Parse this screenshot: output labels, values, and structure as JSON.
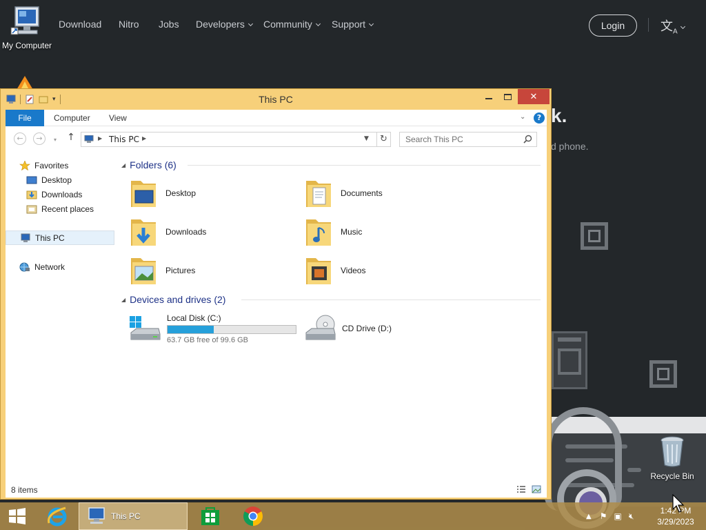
{
  "website": {
    "nav": [
      "Download",
      "Nitro",
      "Jobs",
      "Developers",
      "Community",
      "Support"
    ],
    "login_label": "Login",
    "hero_fragment": "k.",
    "hero_sub_fragment": "d phone."
  },
  "desktop": {
    "my_computer_label": "My Computer",
    "recycle_bin_label": "Recycle Bin"
  },
  "window": {
    "title": "This PC",
    "ribbon_tabs": [
      "File",
      "Computer",
      "View"
    ],
    "address": "This PC",
    "search_placeholder": "Search This PC",
    "nav_pane": {
      "favorites": "Favorites",
      "desktop": "Desktop",
      "downloads": "Downloads",
      "recent_places": "Recent places",
      "this_pc": "This PC",
      "network": "Network"
    },
    "folders_header": "Folders (6)",
    "folders": [
      "Desktop",
      "Documents",
      "Downloads",
      "Music",
      "Pictures",
      "Videos"
    ],
    "devices_header": "Devices and drives (2)",
    "drives": [
      {
        "name": "Local Disk (C:)",
        "free": "63.7 GB free of 99.6 GB",
        "used_fraction": 0.36
      },
      {
        "name": "CD Drive (D:)"
      }
    ],
    "status": "8 items"
  },
  "taskbar": {
    "explorer_task_label": "This PC",
    "clock_time": "1:42 PM",
    "clock_date": "3/29/2023"
  },
  "colors": {
    "window_frame": "#f7d07a",
    "accent": "#1979ca",
    "close": "#c7463b",
    "drive_fill": "#26a0da"
  }
}
